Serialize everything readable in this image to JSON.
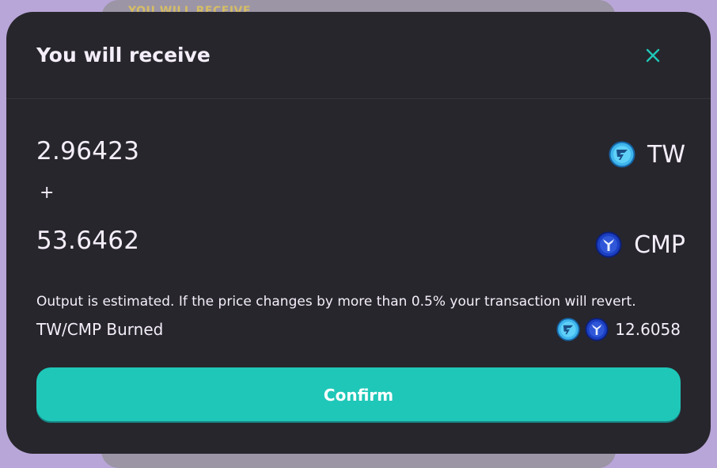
{
  "backdrop": {
    "title": "YOU WILL RECEIVE"
  },
  "modal": {
    "title": "You will receive",
    "close_icon": "close-icon"
  },
  "receive": [
    {
      "amount": "2.96423",
      "symbol": "TW",
      "icon": "tw-token-icon"
    },
    {
      "amount": "53.6462",
      "symbol": "CMP",
      "icon": "cmp-token-icon"
    }
  ],
  "separator": "+",
  "note": "Output is estimated. If the price changes by more than 0.5% your transaction will revert.",
  "burned": {
    "label": "TW/CMP Burned",
    "value": "12.6058"
  },
  "confirm_label": "Confirm",
  "colors": {
    "accent": "#1fc7b8",
    "modal_bg": "#27262c",
    "page_bg": "#b9a6d8"
  }
}
